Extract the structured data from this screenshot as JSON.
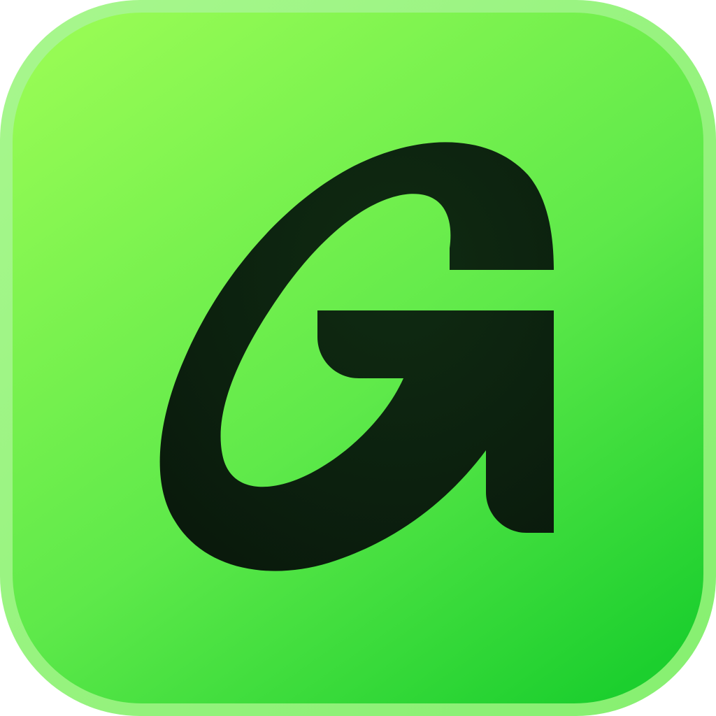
{
  "icon": {
    "name": "app-icon",
    "glyph": "G",
    "glyph_icon": "letter-g-arrow-icon",
    "colors": {
      "rim_top": "#a8f78e",
      "rim_bottom": "#86ef70",
      "face_top": "#96fb54",
      "face_mid": "#5ee94a",
      "face_bottom": "#1ccf2e",
      "glyph_light": "#0f2b12",
      "glyph_dark": "#0a1a0c"
    }
  }
}
